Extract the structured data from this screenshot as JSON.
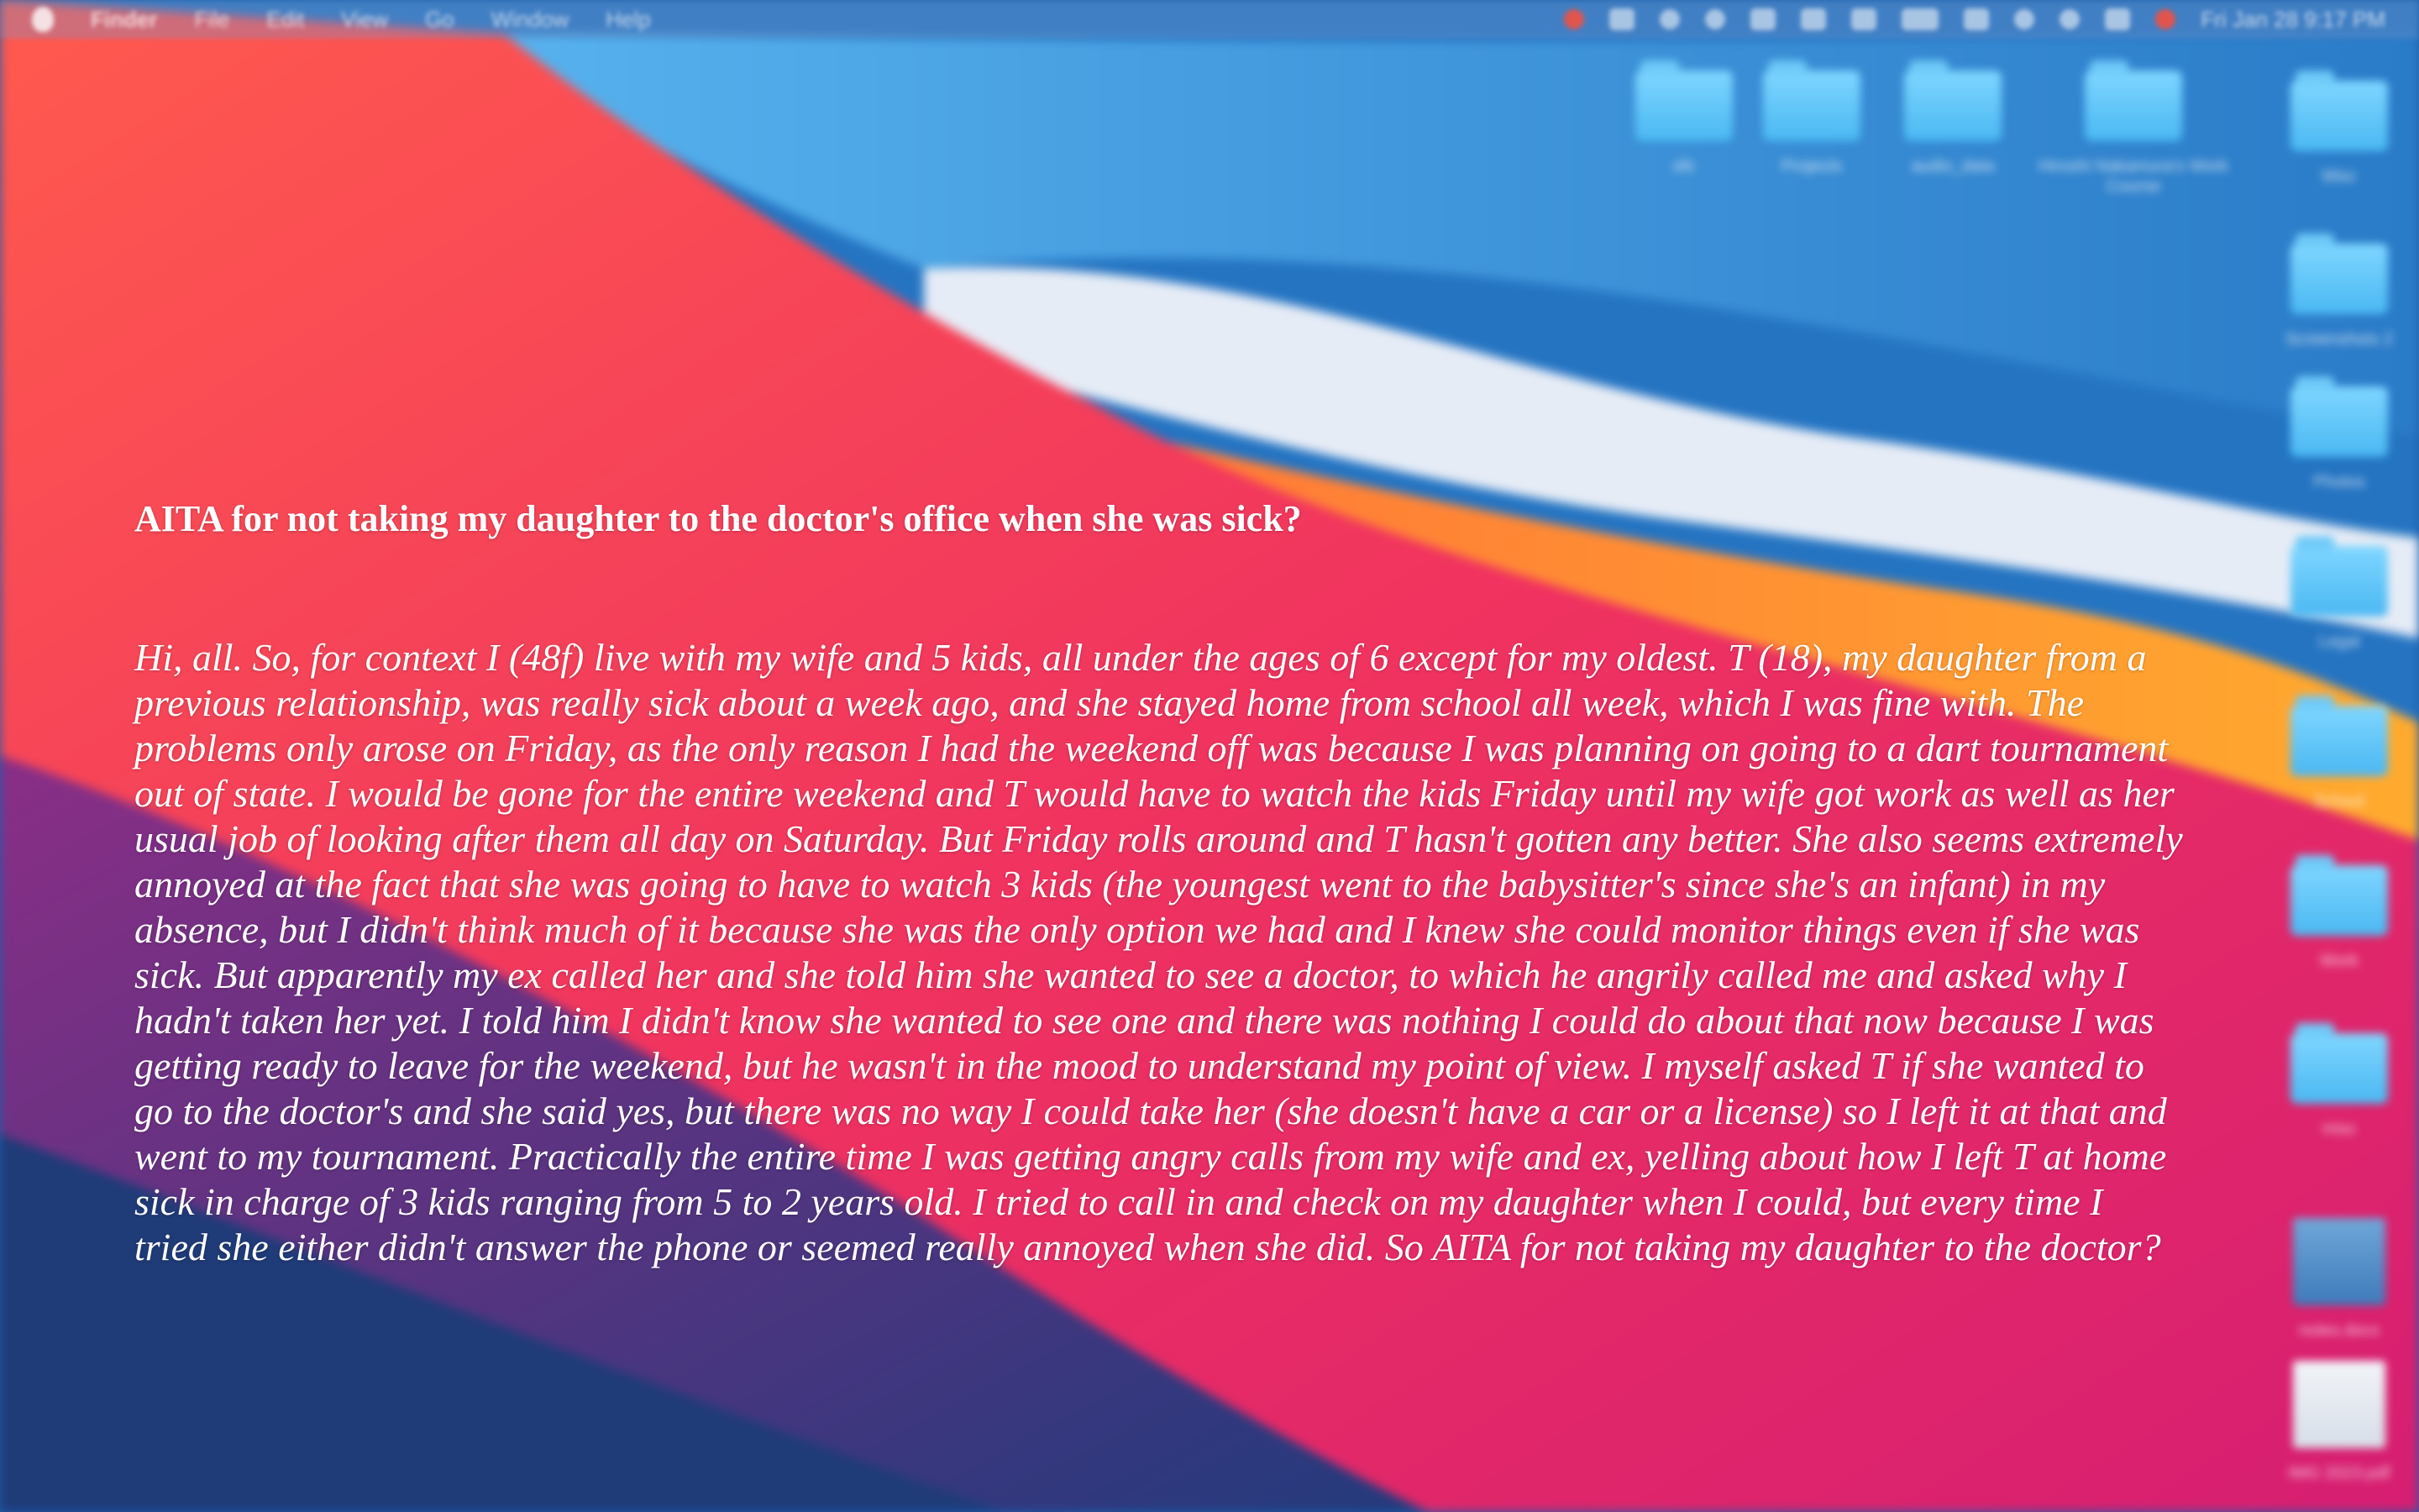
{
  "menubar": {
    "app_name": "Finder",
    "menus": [
      "File",
      "Edit",
      "View",
      "Go",
      "Window",
      "Help"
    ],
    "clock": "Fri Jan 28 9:17 PM"
  },
  "desktop": {
    "top_icons": [
      {
        "label": "ofc",
        "icon": "folder-icon"
      },
      {
        "label": "Projects",
        "icon": "folder-icon"
      },
      {
        "label": "audio_data",
        "icon": "folder-icon"
      },
      {
        "label": "Hiroshi Nakamura's Work Course",
        "icon": "folder-icon"
      }
    ],
    "side_icons": [
      {
        "label": "Misc",
        "icon": "folder-icon"
      },
      {
        "label": "Screenshots 2",
        "icon": "folder-icon"
      },
      {
        "label": "Photos",
        "icon": "folder-icon"
      },
      {
        "label": "Legal",
        "icon": "folder-icon"
      },
      {
        "label": "School",
        "icon": "folder-icon"
      },
      {
        "label": "Work",
        "icon": "folder-icon"
      },
      {
        "label": "misc",
        "icon": "folder-icon"
      },
      {
        "label": "notes.docx",
        "icon": "document-icon"
      },
      {
        "label": "IMG 2023.pdf",
        "icon": "document-icon"
      }
    ]
  },
  "post": {
    "title": "AITA for not taking my daughter to the doctor's office when she was sick?",
    "body": "Hi, all. So, for context I (48f) live with my wife and 5 kids, all under the ages of 6 except for my oldest. T (18), my daughter from a previous relationship, was really sick about a week ago, and she stayed home from school all week, which I was fine with. The problems only arose on Friday, as the only reason I had the weekend off was because I was planning on going to a dart tournament out of state. I would be gone for the entire weekend and T would have to watch the kids Friday until my wife got work as well as her usual job of looking after them all day on Saturday. But Friday rolls around and T hasn't gotten any better. She also seems extremely annoyed at the fact that she was going to have to watch 3 kids (the youngest went to the babysitter's since she's an infant) in my absence, but I didn't think much of it because she was the only option we had and I knew she could monitor things even if she was sick. But apparently my ex called her and she told him she wanted to see a doctor, to which he angrily called me and asked why I hadn't taken her yet. I told him I didn't know she wanted to see one and there was nothing I could do about that now because I was getting ready to leave for the weekend, but he wasn't in the mood to understand my point of view. I myself asked T if she wanted to go to the doctor's and she said yes, but there was no way I could take her (she doesn't have a car or a license) so I left it at that and went to my tournament. Practically the entire time I was getting angry calls from my wife and ex, yelling about how I left T at home sick in charge of 3 kids ranging from 5 to 2 years old. I tried to call in and check on my daughter when I could, but every time I tried she either didn't answer the phone or seemed really annoyed when she did. So AITA for not taking my daughter to the doctor?"
  }
}
